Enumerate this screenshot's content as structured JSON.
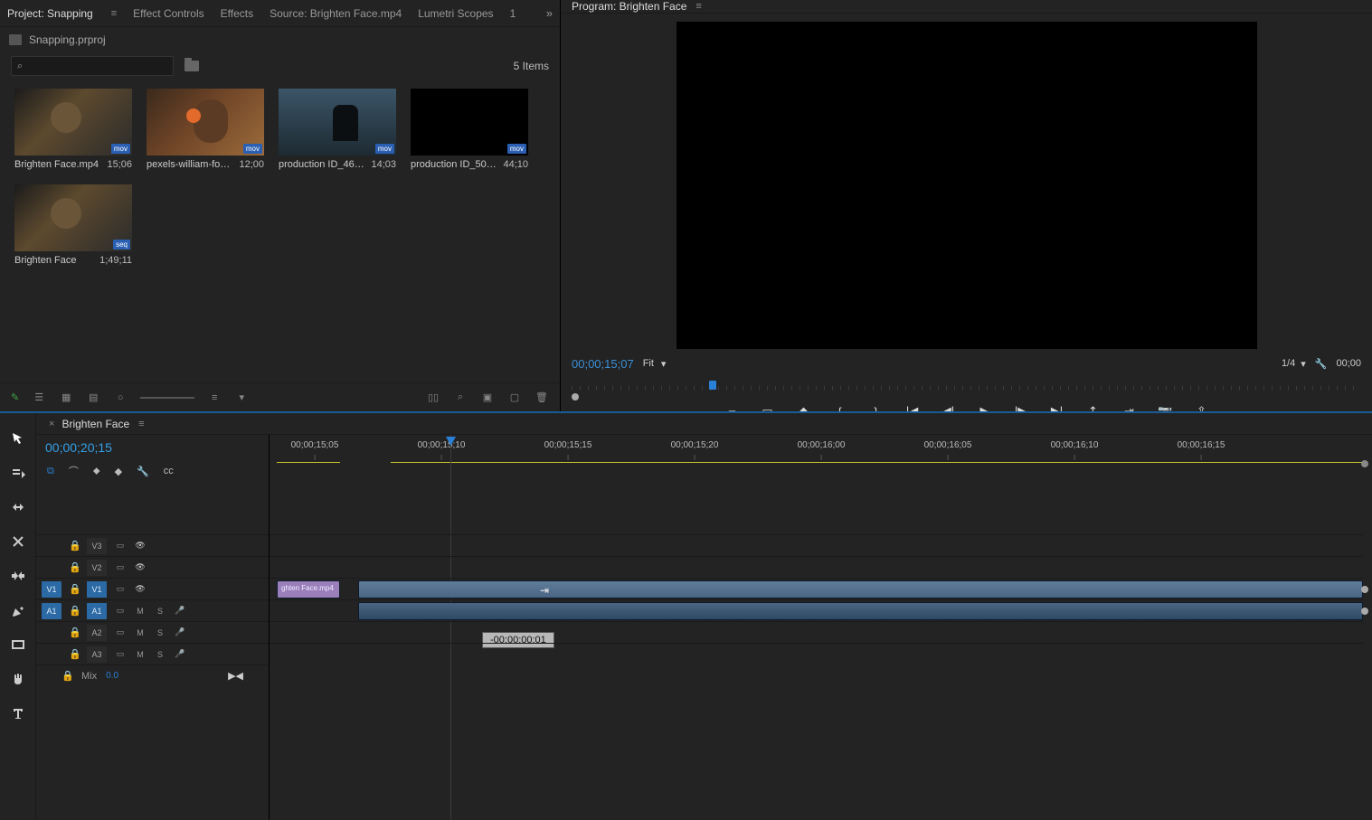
{
  "topTabs": {
    "project": "Project: Snapping",
    "effectControls": "Effect Controls",
    "effects": "Effects",
    "source": "Source: Brighten Face.mp4",
    "lumetri": "Lumetri Scopes",
    "pageNum": "1",
    "more": "»"
  },
  "project": {
    "name": "Snapping.prproj",
    "searchPlaceholder": "",
    "itemsCount": "5 Items",
    "bins": [
      {
        "name": "Brighten Face.mp4",
        "dur": "15;06",
        "thumb": "face",
        "badge": "mov"
      },
      {
        "name": "pexels-william-fort…",
        "dur": "12;00",
        "thumb": "port",
        "badge": "mov"
      },
      {
        "name": "production ID_461…",
        "dur": "14;03",
        "thumb": "prod",
        "badge": "mov"
      },
      {
        "name": "production ID_509…",
        "dur": "44;10",
        "thumb": "black",
        "badge": "mov"
      },
      {
        "name": "Brighten Face",
        "dur": "1;49;11",
        "thumb": "face",
        "badge": "seq"
      }
    ]
  },
  "program": {
    "title": "Program: Brighten Face",
    "timecode": "00;00;15;07",
    "fit": "Fit",
    "scale": "1/4",
    "outTimecode": "00;00"
  },
  "timeline": {
    "sequence": "Brighten Face",
    "timecode": "00;00;20;15",
    "ruler": [
      "00;00;15;05",
      "00;00;15;10",
      "00;00;15;15",
      "00;00;15;20",
      "00;00;16;00",
      "00;00;16;05",
      "00;00;16;10",
      "00;00;16;15"
    ],
    "tracks": {
      "v3": "V3",
      "v2": "V2",
      "v1": "V1",
      "a1": "A1",
      "a2": "A2",
      "a3": "A3",
      "srcV": "V1",
      "srcA": "A1",
      "mix": "Mix",
      "mixDb": "0.0"
    },
    "clips": {
      "purpleLabel": "ghten Face.mp4",
      "offset": "-00:00:00:01"
    },
    "toggles": {
      "m": "M",
      "s": "S"
    }
  }
}
